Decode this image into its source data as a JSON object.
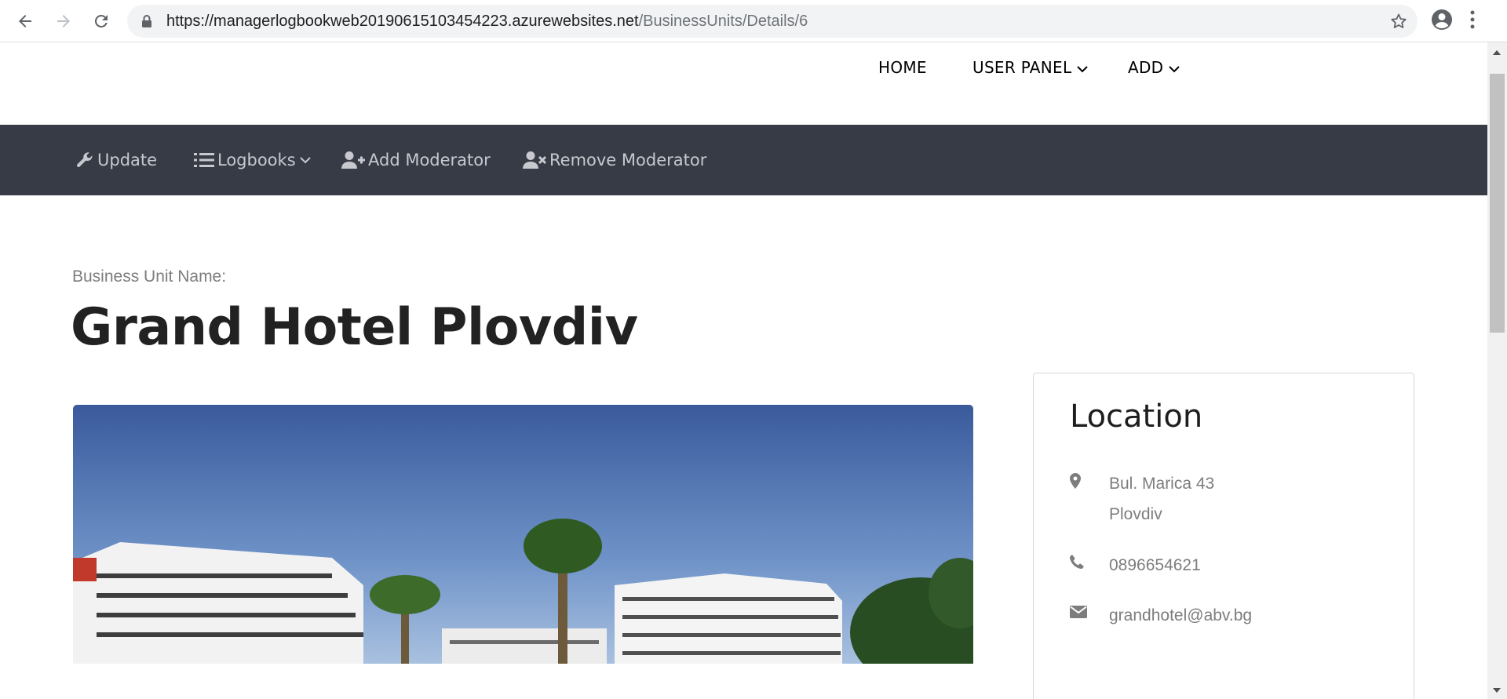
{
  "browser": {
    "url_host": "https://managerlogbookweb20190615103454223.azurewebsites.net",
    "url_path": "/BusinessUnits/Details/6",
    "icons": [
      "back-arrow-icon",
      "forward-arrow-icon",
      "reload-icon",
      "lock-icon",
      "star-icon",
      "account-icon",
      "kebab-menu-icon"
    ]
  },
  "top_nav": {
    "home": "HOME",
    "user_panel": "USER PANEL",
    "add": "ADD"
  },
  "sub_nav": {
    "update": "Update",
    "logbooks": "Logbooks",
    "add_moderator": "Add Moderator",
    "remove_moderator": "Remove Moderator",
    "icons": [
      "wrench-icon",
      "list-icon",
      "user-plus-icon",
      "user-times-icon"
    ]
  },
  "business_unit": {
    "label": "Business Unit Name:",
    "name": "Grand Hotel Plovdiv"
  },
  "location": {
    "heading": "Location",
    "address_line1": "Bul. Marica 43",
    "address_line2": "Plovdiv",
    "phone": "0896654621",
    "email": "grandhotel@abv.bg"
  },
  "colors": {
    "sub_nav_bg": "#373b45",
    "sub_nav_text": "#c7c9cf",
    "muted_text": "#7d7d7d"
  }
}
